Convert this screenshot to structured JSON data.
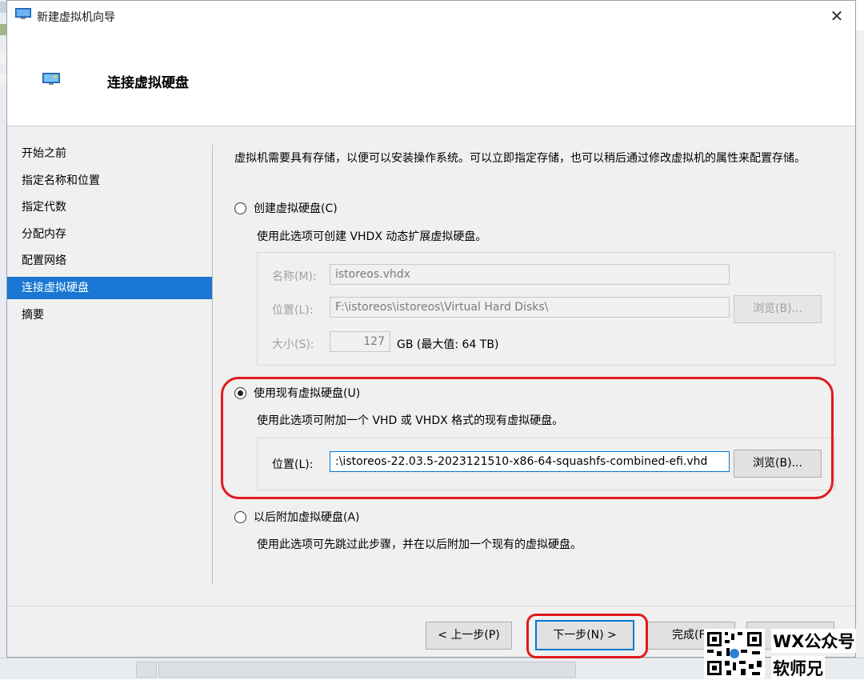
{
  "window": {
    "title": "新建虚拟机向导",
    "close_glyph": "✕"
  },
  "header": {
    "title": "连接虚拟硬盘"
  },
  "nav": {
    "items": [
      {
        "label": "开始之前"
      },
      {
        "label": "指定名称和位置"
      },
      {
        "label": "指定代数"
      },
      {
        "label": "分配内存"
      },
      {
        "label": "配置网络"
      },
      {
        "label": "连接虚拟硬盘",
        "active": true
      },
      {
        "label": "摘要"
      }
    ]
  },
  "content": {
    "intro": "虚拟机需要具有存储，以便可以安装操作系统。可以立即指定存储，也可以稍后通过修改虚拟机的属性来配置存储。",
    "option_create": {
      "label": "创建虚拟硬盘(C)",
      "selected": false,
      "description": "使用此选项可创建 VHDX 动态扩展虚拟硬盘。",
      "name_label": "名称(M):",
      "name_value": "istoreos.vhdx",
      "location_label": "位置(L):",
      "location_value": "F:\\istoreos\\istoreos\\Virtual Hard Disks\\",
      "browse_label": "浏览(B)...",
      "size_label": "大小(S):",
      "size_value": "127",
      "size_unit": "GB (最大值: 64 TB)"
    },
    "option_existing": {
      "label": "使用现有虚拟硬盘(U)",
      "selected": true,
      "description": "使用此选项可附加一个 VHD 或 VHDX 格式的现有虚拟硬盘。",
      "location_label": "位置(L):",
      "location_value": ":\\istoreos-22.03.5-2023121510-x86-64-squashfs-combined-efi.vhd",
      "browse_label": "浏览(B)..."
    },
    "option_later": {
      "label": "以后附加虚拟硬盘(A)",
      "selected": false,
      "description": "使用此选项可先跳过此步骤，并在以后附加一个现有的虚拟硬盘。"
    }
  },
  "footer": {
    "prev_label": "< 上一步(P)",
    "next_label": "下一步(N) >",
    "finish_label": "完成(F"
  },
  "watermark": {
    "line1": "WX公众号",
    "line2": "软师兄"
  },
  "colors": {
    "accent": "#1976d2",
    "highlight_red": "#e0191c",
    "focus_blue": "#0078d7"
  }
}
